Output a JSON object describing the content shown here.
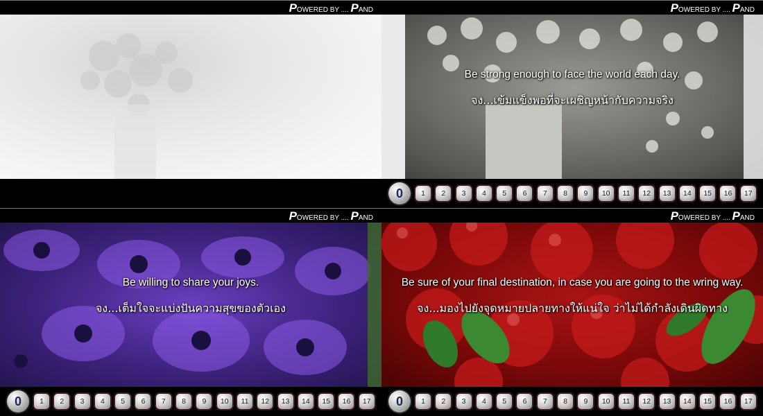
{
  "powered_by": {
    "cap1": "P",
    "rest1": "OWERED BY .... ",
    "cap2": "P",
    "rest2": "AND"
  },
  "panels": [
    {
      "caption_en": "",
      "caption_th": ""
    },
    {
      "caption_en": "Be strong enough to face the world each day.",
      "caption_th": "จง...เข้มแข็งพอที่จะเผชิญหน้ากับความจริง"
    },
    {
      "caption_en": "Be willing to share your joys.",
      "caption_th": "จง...เต็มใจจะแบ่งปันความสุขของตัวเอง"
    },
    {
      "caption_en": "Be sure of your final destination, in case you are going to the wring way.",
      "caption_th": "จง...มองไปยังจุดหมายปลายทางให้แน่ใจ ว่าไม่ได้กำลังเดินผิดทาง"
    }
  ],
  "nav_buttons": [
    "0",
    "1",
    "2",
    "3",
    "4",
    "5",
    "6",
    "7",
    "8",
    "9",
    "10",
    "11",
    "12",
    "13",
    "14",
    "15",
    "16",
    "17"
  ],
  "colors": {
    "background": "#000000",
    "caption": "#ffffff",
    "nav_zero_text": "#1a2a5a"
  }
}
